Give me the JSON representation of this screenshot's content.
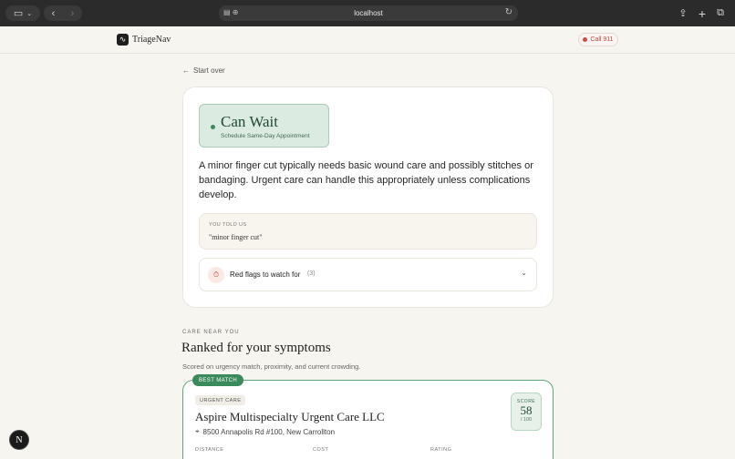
{
  "browser": {
    "url": "localhost",
    "icons": [
      "sidebar-icon",
      "chevron-down-icon",
      "back-icon",
      "forward-icon",
      "reader-icon",
      "reload-icon",
      "share-icon",
      "plus-icon",
      "tabs-icon"
    ]
  },
  "app": {
    "brand": "TriageNav",
    "call_label": "Call 911",
    "accent": "#3b8a5b",
    "danger": "#d24a3e"
  },
  "nav": {
    "start_over": "Start over"
  },
  "triage": {
    "level": "Can Wait",
    "action": "Schedule Same-Day Appointment",
    "summary": "A minor finger cut typically needs basic wound care and possibly stitches or bandaging. Urgent care can handle this appropriately unless complications develop."
  },
  "told_us": {
    "label": "YOU TOLD US",
    "quote": "\"minor finger cut\""
  },
  "red_flags": {
    "label": "Red flags to watch for",
    "count": "(3)"
  },
  "care": {
    "eyebrow": "CARE NEAR YOU",
    "title": "Ranked for your symptoms",
    "subtitle": "Scored on urgency match, proximity, and current crowding."
  },
  "result": {
    "badge": "BEST MATCH",
    "type": "URGENT CARE",
    "name": "Aspire Multispecialty Urgent Care LLC",
    "address": "8500 Annapolis Rd #100, New Carrollton",
    "score_label": "SCORE",
    "score": "58",
    "score_max": "/ 100",
    "meta_labels": [
      "DISTANCE",
      "COST",
      "RATING"
    ]
  },
  "dev": {
    "fab_label": "N"
  }
}
